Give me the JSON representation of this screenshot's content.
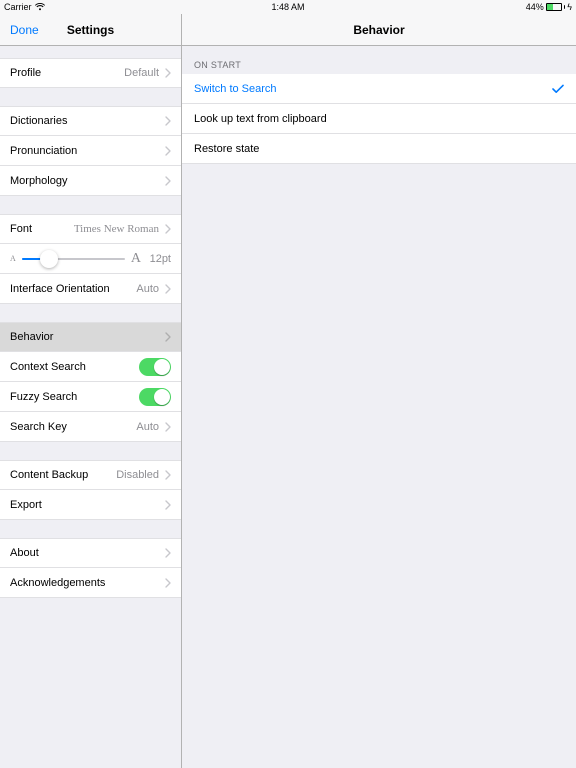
{
  "status": {
    "carrier": "Carrier",
    "time": "1:48 AM",
    "battery_pct": "44%"
  },
  "sidebar": {
    "done": "Done",
    "title": "Settings",
    "profile": {
      "label": "Profile",
      "value": "Default"
    },
    "dictionaries": {
      "label": "Dictionaries"
    },
    "pronunciation": {
      "label": "Pronunciation"
    },
    "morphology": {
      "label": "Morphology"
    },
    "font": {
      "label": "Font",
      "value": "Times New Roman",
      "size_label": "12pt"
    },
    "orientation": {
      "label": "Interface Orientation",
      "value": "Auto"
    },
    "behavior": {
      "label": "Behavior"
    },
    "context_search": {
      "label": "Context Search"
    },
    "fuzzy_search": {
      "label": "Fuzzy Search"
    },
    "search_key": {
      "label": "Search Key",
      "value": "Auto"
    },
    "content_backup": {
      "label": "Content Backup",
      "value": "Disabled"
    },
    "export": {
      "label": "Export"
    },
    "about": {
      "label": "About"
    },
    "ack": {
      "label": "Acknowledgements"
    }
  },
  "detail": {
    "title": "Behavior",
    "section": "On Start",
    "options": {
      "switch_search": "Switch to Search",
      "clipboard": "Look up text from clipboard",
      "restore": "Restore state"
    },
    "selected_index": 0
  }
}
